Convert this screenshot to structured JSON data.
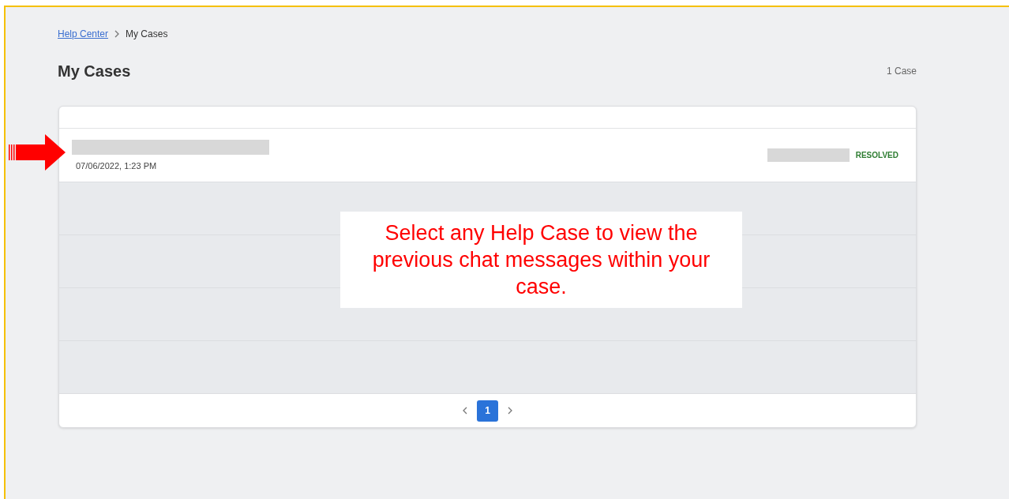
{
  "breadcrumb": [
    {
      "label": "Help Center",
      "kind": "link"
    },
    {
      "label": "My Cases",
      "kind": "current"
    }
  ],
  "title": "My Cases",
  "case_count": "1 Case",
  "cases": [
    {
      "date": "07/06/2022, 1:23 PM",
      "status": "RESOLVED",
      "color": "#2e7d32"
    }
  ],
  "pagination": {
    "pages": [
      {
        "label": "1",
        "selected": true
      }
    ]
  },
  "annotation": {
    "text": "Select any Help Case to view the previous chat messages within your case."
  }
}
